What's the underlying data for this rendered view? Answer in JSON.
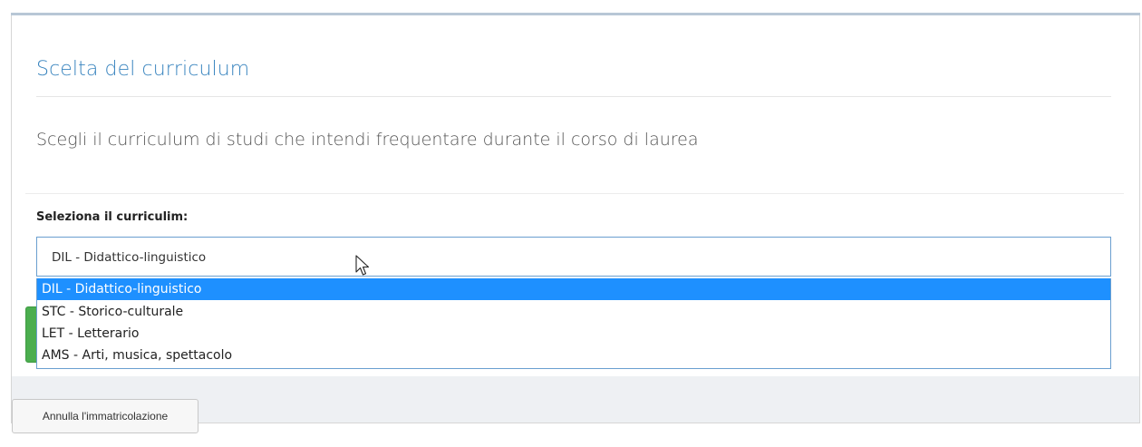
{
  "page": {
    "title": "Scelta del curriculum",
    "intro": "Scegli il curriculum di studi che intendi frequentare durante il corso di laurea"
  },
  "form": {
    "label": "Seleziona il curriculim:",
    "selected_value": "DIL - Didattico-linguistico",
    "options": [
      {
        "label": "DIL - Didattico-linguistico",
        "highlighted": true
      },
      {
        "label": "STC - Storico-culturale",
        "highlighted": false
      },
      {
        "label": "LET - Letterario",
        "highlighted": false
      },
      {
        "label": "AMS - Arti, musica, spettacolo",
        "highlighted": false
      }
    ]
  },
  "footer": {
    "cancel_label": "Annulla l'immatricolazione"
  },
  "colors": {
    "title": "#3a85bf",
    "highlight": "#1e90ff",
    "green_button": "#4bae4f"
  },
  "icons": {
    "cursor": "mouse-pointer-icon"
  }
}
